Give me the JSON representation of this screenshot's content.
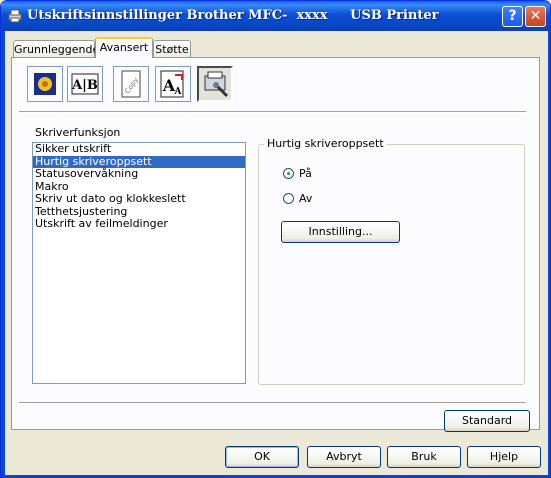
{
  "window": {
    "title": "Utskriftsinnstillinger Brother MFC-  xxxx     USB Printer",
    "help_glyph": "?",
    "close_glyph": "✕"
  },
  "tabs": [
    {
      "label": "Grunnleggende"
    },
    {
      "label": "Avansert",
      "active": true
    },
    {
      "label": "Støtte"
    }
  ],
  "toolbar": {
    "icons": [
      "quality-icon",
      "duplex-icon",
      "watermark-icon",
      "scaling-icon",
      "device-options-icon"
    ],
    "duplex_text": "A|B",
    "watermark_text": "Copy",
    "scaling_text": "A"
  },
  "functions": {
    "label": "Skriverfunksjon",
    "items": [
      "Sikker utskrift",
      "Hurtig skriveroppsett",
      "Statusovervåkning",
      "Makro",
      "Skriv ut dato og klokkeslett",
      "Tetthetsjustering",
      "Utskrift av feilmeldinger"
    ],
    "selected_index": 1
  },
  "quick_setup": {
    "title": "Hurtig skriveroppsett",
    "on_label": "På",
    "off_label": "Av",
    "selected": "on",
    "settings_button": "Innstilling..."
  },
  "buttons": {
    "standard": "Standard",
    "ok": "OK",
    "cancel": "Avbryt",
    "apply": "Bruk",
    "help": "Hjelp"
  },
  "colors": {
    "titlebar": "#0a4fd6",
    "selection": "#316ac5",
    "active_tab_accent": "#ffc83c"
  }
}
